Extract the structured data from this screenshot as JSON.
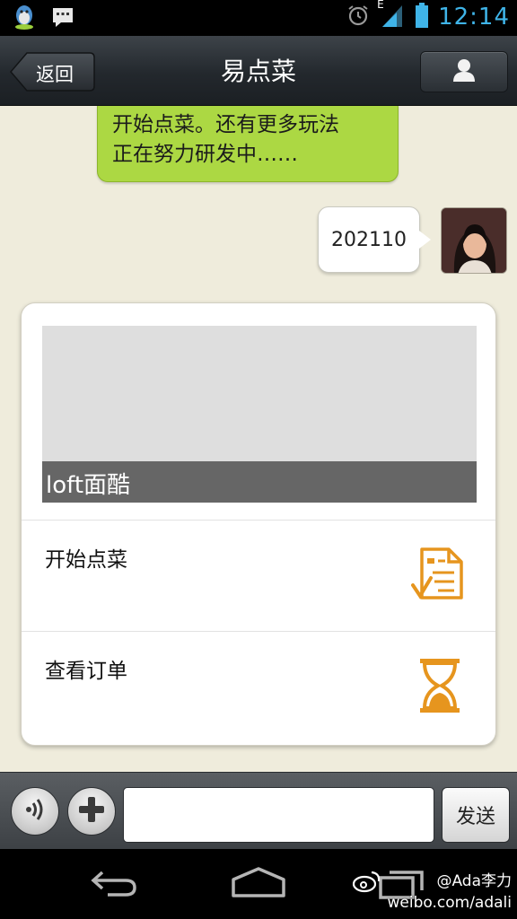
{
  "status_bar": {
    "clock": "12:14",
    "network": "E",
    "accent_color": "#3fb4e8",
    "left_icons": [
      "qq-icon",
      "message-icon"
    ],
    "right_icons": [
      "alarm-icon",
      "signal-icon",
      "battery-icon"
    ]
  },
  "title_bar": {
    "back_label": "返回",
    "title": "易点菜",
    "profile_icon": "person-icon"
  },
  "chat": {
    "messages": [
      {
        "side": "left",
        "text": "开始点菜。还有更多玩法\n正在努力研发中……",
        "color": "#acd843"
      },
      {
        "side": "right",
        "text": "202110",
        "color": "#ffffff"
      }
    ],
    "card": {
      "cover_title": "loft面酷",
      "items": [
        {
          "label": "开始点菜",
          "icon": "order-form-icon"
        },
        {
          "label": "查看订单",
          "icon": "hourglass-icon"
        }
      ],
      "icon_color": "#e6951e"
    }
  },
  "input_bar": {
    "voice_icon": "voice-icon",
    "plus_icon": "plus-icon",
    "input_value": "",
    "send_label": "发送"
  },
  "nav_bar": {
    "buttons": [
      "back-nav-icon",
      "home-nav-icon",
      "recent-apps-icon"
    ],
    "watermark_line1": "@Ada李力",
    "watermark_line2": "weibo.com/adali"
  }
}
